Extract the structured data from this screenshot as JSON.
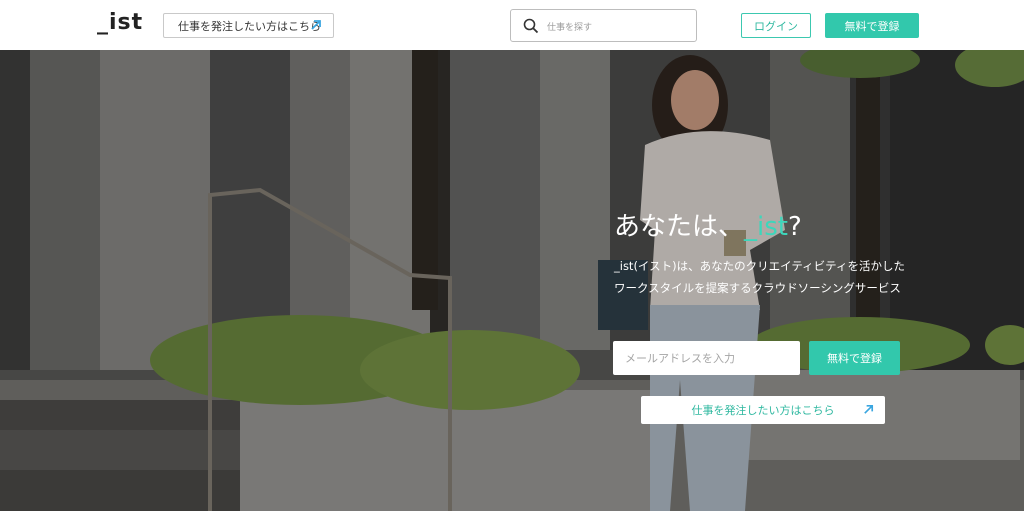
{
  "header": {
    "logo": "_ist",
    "post_job_label": "仕事を発注したい方はこちら",
    "search_placeholder": "仕事を探す",
    "login_label": "ログイン",
    "signup_label": "無料で登録"
  },
  "hero": {
    "headline_prefix": "あなたは、",
    "headline_accent": "_ist",
    "headline_suffix": "?",
    "subtext_line1": "_ist(イスト)は、あなたのクリエイティビティを活かした",
    "subtext_line2": "ワークスタイルを提案するクラウドソーシングサービス",
    "email_placeholder": "メールアドレスを入力",
    "signup_label": "無料で登録",
    "post_job_label": "仕事を発注したい方はこちら"
  },
  "colors": {
    "accent": "#32c8ac",
    "headline_accent": "#3dd6bb"
  },
  "icons": {
    "search": "search-icon",
    "external": "arrow-up-right-icon"
  }
}
